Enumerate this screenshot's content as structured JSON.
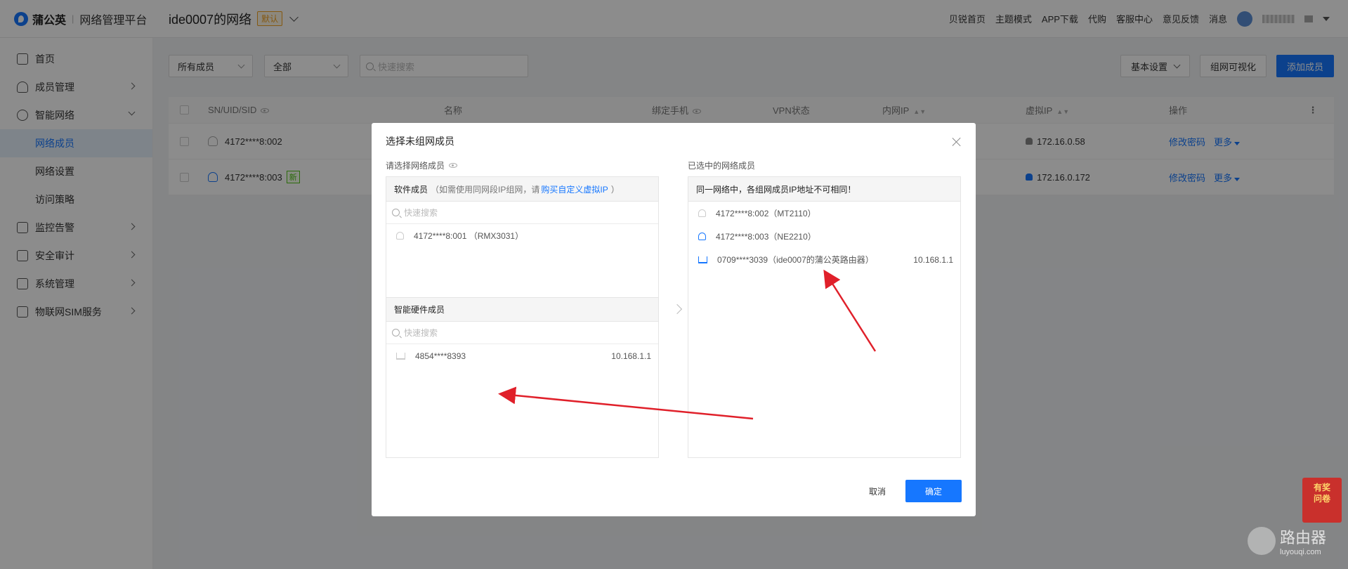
{
  "brand": {
    "name": "蒲公英",
    "platform": "网络管理平台"
  },
  "network": {
    "title": "ide0007的网络",
    "default_badge": "默认"
  },
  "topnav": [
    "贝锐首页",
    "主题模式",
    "APP下载",
    "代购",
    "客服中心",
    "意见反馈",
    "消息"
  ],
  "sidebar": {
    "items": [
      {
        "label": "首页",
        "icon": "home-icon"
      },
      {
        "label": "成员管理",
        "icon": "user-icon"
      },
      {
        "label": "智能网络",
        "icon": "network-icon"
      },
      {
        "label": "监控告警",
        "icon": "monitor-icon"
      },
      {
        "label": "安全审计",
        "icon": "audit-icon"
      },
      {
        "label": "系统管理",
        "icon": "settings-icon"
      },
      {
        "label": "物联网SIM服务",
        "icon": "sim-icon"
      }
    ],
    "sub": [
      "网络成员",
      "网络设置",
      "访问策略"
    ]
  },
  "filters": {
    "member_type": "所有成员",
    "status": "全部",
    "search_placeholder": "快速搜索"
  },
  "actions": {
    "basic_settings": "基本设置",
    "visualize": "组网可视化",
    "add_member": "添加成员"
  },
  "table": {
    "headers": [
      "SN/UID/SID",
      "名称",
      "绑定手机",
      "VPN状态",
      "内网IP",
      "虚拟IP",
      "操作"
    ],
    "rows": [
      {
        "id": "4172****8:002",
        "virtual_ip": "172.16.0.58",
        "op1": "修改密码",
        "op2": "更多"
      },
      {
        "id": "4172****8:003",
        "tag": "新",
        "virtual_ip": "172.16.0.172",
        "op1": "修改密码",
        "op2": "更多"
      }
    ]
  },
  "modal": {
    "title": "选择未组网成员",
    "left_label": "请选择网络成员",
    "right_label": "已选中的网络成员",
    "software": {
      "title": "软件成员",
      "hint_prefix": "（如需使用同网段IP组网，请",
      "hint_link": "购买自定义虚拟IP",
      "hint_suffix": "）",
      "search_placeholder": "快速搜索",
      "items": [
        {
          "label": "4172****8:001 （RMX3031）"
        }
      ]
    },
    "hardware": {
      "title": "智能硬件成员",
      "search_placeholder": "快速搜索",
      "items": [
        {
          "label": "4854****8393",
          "ip": "10.168.1.1"
        }
      ]
    },
    "selected": {
      "notice": "同一网络中，各组网成员IP地址不可相同！",
      "items": [
        {
          "label": "4172****8:002（MT2110）",
          "ip": ""
        },
        {
          "label": "4172****8:003（NE2210）",
          "ip": ""
        },
        {
          "label": "0709****3039（ide0007的蒲公英路由器）",
          "ip": "10.168.1.1"
        }
      ]
    },
    "cancel": "取消",
    "ok": "确定"
  },
  "promo": {
    "line1": "有奖",
    "line2": "问卷"
  },
  "watermark": {
    "big": "路由器",
    "small": "luyouqi.com"
  },
  "colors": {
    "accent": "#1677ff",
    "annotation": "#e0202a"
  }
}
